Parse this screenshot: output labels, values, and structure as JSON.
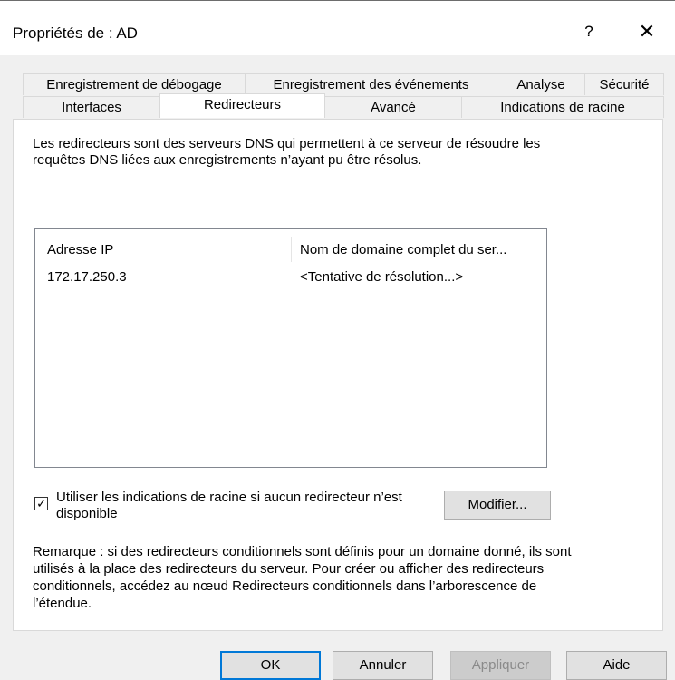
{
  "window": {
    "title": "Propriétés de : AD",
    "help_label": "?",
    "close_label": "✕"
  },
  "tabs": {
    "row1": [
      {
        "label": "Enregistrement de débogage"
      },
      {
        "label": "Enregistrement des événements"
      },
      {
        "label": "Analyse"
      },
      {
        "label": "Sécurité"
      }
    ],
    "row2": [
      {
        "label": "Interfaces"
      },
      {
        "label": "Redirecteurs",
        "selected": true
      },
      {
        "label": "Avancé"
      },
      {
        "label": "Indications de racine"
      }
    ]
  },
  "redirecteurs": {
    "description": "Les redirecteurs sont des serveurs DNS qui permettent à ce serveur de résoudre les requêtes DNS liées aux enregistrements n’ayant pu être résolus.",
    "list": {
      "columns": [
        "Adresse IP",
        "Nom de domaine complet du ser..."
      ],
      "rows": [
        {
          "ip": "172.17.250.3",
          "fqdn": "<Tentative de résolution...>"
        }
      ]
    },
    "use_root_hints": {
      "label": "Utiliser les indications de racine si aucun redirecteur n’est disponible",
      "checked": true
    },
    "edit_button": "Modifier...",
    "note": "Remarque : si des redirecteurs conditionnels sont définis pour un domaine donné, ils sont utilisés à la place des redirecteurs du serveur. Pour créer ou afficher des redirecteurs conditionnels, accédez au nœud Redirecteurs conditionnels dans l’arborescence de l’étendue."
  },
  "buttons": {
    "ok": "OK",
    "cancel": "Annuler",
    "apply": "Appliquer",
    "help": "Aide"
  }
}
